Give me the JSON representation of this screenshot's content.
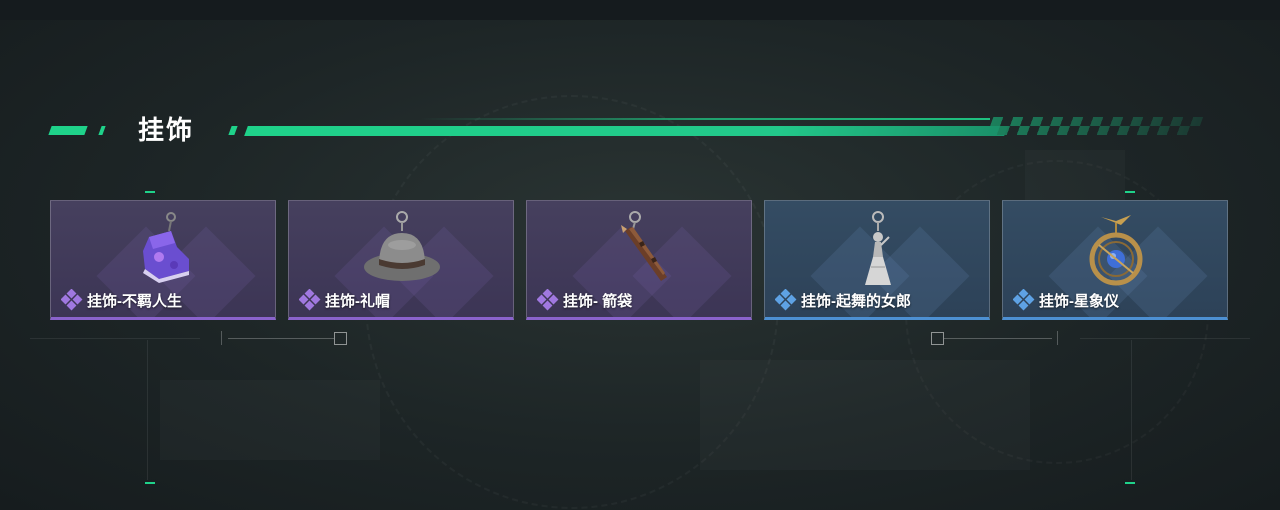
{
  "section": {
    "title": "挂饰"
  },
  "items": [
    {
      "label": "挂饰-不羁人生",
      "rarity": "purple",
      "icon": "sneaker-charm-icon"
    },
    {
      "label": "挂饰-礼帽",
      "rarity": "purple",
      "icon": "fedora-hat-charm-icon"
    },
    {
      "label": "挂饰- 箭袋",
      "rarity": "purple",
      "icon": "quiver-charm-icon"
    },
    {
      "label": "挂饰-起舞的女郎",
      "rarity": "blue",
      "icon": "dancing-lady-charm-icon"
    },
    {
      "label": "挂饰-星象仪",
      "rarity": "blue",
      "icon": "astrolabe-charm-icon"
    }
  ],
  "colors": {
    "accent": "#1fd28a",
    "purple": "#8a63cc",
    "blue": "#4d90d3"
  }
}
